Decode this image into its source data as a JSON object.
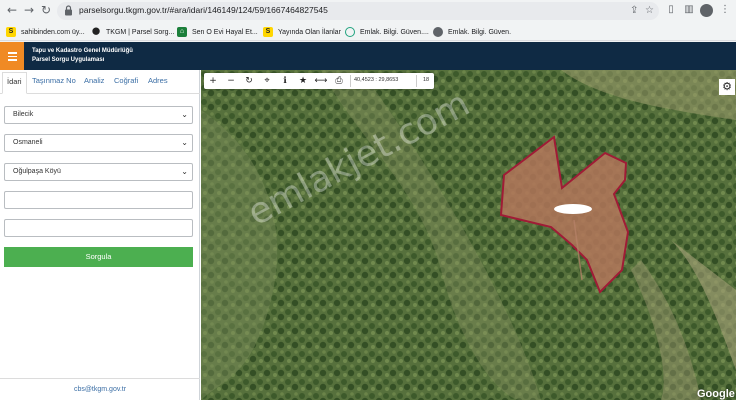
{
  "browser": {
    "url": "parselsorgu.tkgm.gov.tr/#ara/idari/146149/124/59/1667464827545",
    "bookmarks": [
      {
        "label": "sahibinden.com üy...",
        "icon": "sahibinden-icon"
      },
      {
        "label": "TKGM | Parsel Sorg...",
        "icon": "map-pin-icon"
      },
      {
        "label": "Sen O Evi Hayal Et...",
        "icon": "house-icon"
      },
      {
        "label": "Yayında Olan İlanlar",
        "icon": "sahibinden-icon"
      },
      {
        "label": "Emlak. Bilgi. Güven....",
        "icon": "emlakjet-icon"
      },
      {
        "label": "Emlak. Bilgi. Güven.",
        "icon": "globe-icon"
      }
    ]
  },
  "header": {
    "title_line1": "Tapu ve Kadastro Genel Müdürlüğü",
    "title_line2": "Parsel Sorgu Uygulaması"
  },
  "sidebar": {
    "tabs": [
      {
        "label": "İdari",
        "active": true
      },
      {
        "label": "Taşınmaz No"
      },
      {
        "label": "Analiz"
      },
      {
        "label": "Coğrafi"
      },
      {
        "label": "Adres"
      }
    ],
    "selects": [
      {
        "value": "Bilecik"
      },
      {
        "value": "Osmaneli"
      },
      {
        "value": "Oğulpaşa Köyü"
      }
    ],
    "inputs": [
      {
        "value": ""
      },
      {
        "value": ""
      }
    ],
    "submit_label": "Sorgula",
    "footer_email": "cbs@tkgm.gov.tr"
  },
  "map": {
    "coordinates": "40,4523 : 29,8653",
    "zoom": "18",
    "watermark": "emlakjet.com",
    "attribution": "Google",
    "parcel_color": "#c0392b"
  }
}
